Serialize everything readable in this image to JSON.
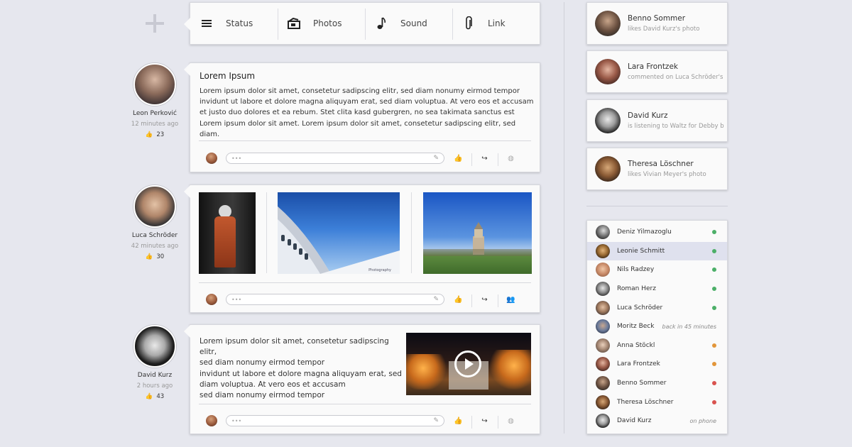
{
  "composer": {
    "buttons": [
      {
        "label": "Status",
        "icon": "menu-icon"
      },
      {
        "label": "Photos",
        "icon": "photos-icon"
      },
      {
        "label": "Sound",
        "icon": "music-note-icon"
      },
      {
        "label": "Link",
        "icon": "paperclip-icon"
      }
    ]
  },
  "posts": [
    {
      "author": {
        "name": "Leon Perković",
        "time": "12 minutes ago",
        "likes": "23"
      },
      "title": "Lorem Ipsum",
      "body": "Lorem ipsum dolor sit amet, consetetur sadipscing elitr, sed diam nonumy eirmod tempor invidunt ut labore et dolore magna aliquyam erat, sed diam voluptua. At vero eos et accusam et justo duo dolores et ea rebum. Stet clita kasd gubergren, no sea takimata sanctus est Lorem ipsum dolor sit amet. Lorem ipsum dolor sit amet, consetetur sadipscing elitr, sed diam."
    },
    {
      "author": {
        "name": "Luca Schröder",
        "time": "42 minutes ago",
        "likes": "30"
      },
      "photo_caption": "Photography"
    },
    {
      "author": {
        "name": "David Kurz",
        "time": "2 hours ago",
        "likes": "43"
      },
      "body_lines": [
        "Lorem ipsum dolor sit amet, consetetur sadipscing elitr,",
        "sed diam nonumy eirmod tempor",
        "invidunt ut labore et dolore magna aliquyam erat, sed",
        "diam voluptua. At vero eos et accusam",
        "sed diam nonumy eirmod tempor"
      ]
    }
  ],
  "comment": {
    "placeholder": "•••"
  },
  "activity": [
    {
      "name": "Benno Sommer",
      "desc": "likes David Kurz's photo"
    },
    {
      "name": "Lara Frontzek",
      "desc": "commented on Luca Schröder's"
    },
    {
      "name": "David Kurz",
      "desc": "is listening to Waltz for Debby b"
    },
    {
      "name": "Theresa Löschner",
      "desc": "likes Vivian Meyer's photo"
    }
  ],
  "contacts": [
    {
      "name": "Deniz Yilmazoglu",
      "status": "#4caf68",
      "note": ""
    },
    {
      "name": "Leonie Schmitt",
      "status": "#4caf68",
      "note": ""
    },
    {
      "name": "Nils Radzey",
      "status": "#4caf68",
      "note": ""
    },
    {
      "name": "Roman Herz",
      "status": "#4caf68",
      "note": ""
    },
    {
      "name": "Luca Schröder",
      "status": "#4caf68",
      "note": ""
    },
    {
      "name": "Moritz Beck",
      "status": "",
      "note": "back in 45 minutes"
    },
    {
      "name": "Anna Stöckl",
      "status": "#e2963a",
      "note": ""
    },
    {
      "name": "Lara Frontzek",
      "status": "#e2963a",
      "note": ""
    },
    {
      "name": "Benno Sommer",
      "status": "#d9534f",
      "note": ""
    },
    {
      "name": "Theresa Löschner",
      "status": "#d9534f",
      "note": ""
    },
    {
      "name": "David Kurz",
      "status": "",
      "note": "on phone"
    }
  ]
}
